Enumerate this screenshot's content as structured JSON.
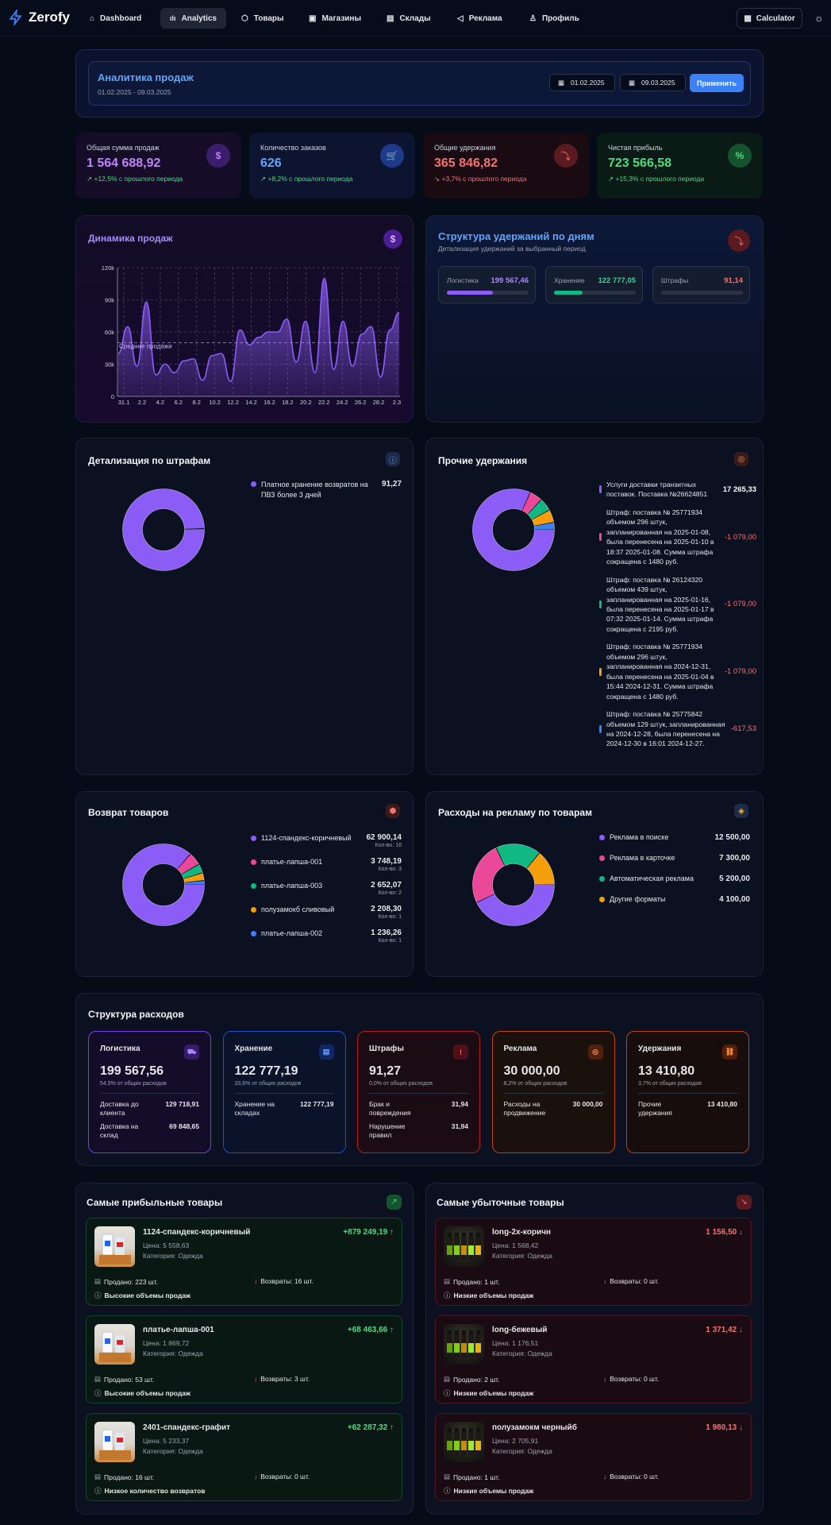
{
  "nav": {
    "logo": "Zerofy",
    "items": [
      "Dashboard",
      "Analytics",
      "Товары",
      "Магазины",
      "Склады",
      "Реклама",
      "Профиль"
    ],
    "calculator": "Calculator"
  },
  "header": {
    "title": "Аналитика продаж",
    "range": "01.02.2025 - 09.03.2025",
    "date_from": "01.02.2025",
    "date_to": "09.03.2025",
    "apply": "Применить"
  },
  "kpis": [
    {
      "label": "Общая сумма продаж",
      "value": "1 564 688,92",
      "trend": "+12,5% с прошлого периода",
      "color": "#c084fc"
    },
    {
      "label": "Количество заказов",
      "value": "626",
      "trend": "+8,2% с прошлого периода",
      "color": "#60a5fa"
    },
    {
      "label": "Общие удержания",
      "value": "365 846,82",
      "trend": "+3,7% с прошлого периода",
      "color": "#f87171"
    },
    {
      "label": "Чистая прибыль",
      "value": "723 566,58",
      "trend": "+15,3% с прошлого периода",
      "color": "#4ade80"
    }
  ],
  "sales_chart": {
    "title": "Динамика продаж",
    "avg_label": "Средние продажи",
    "chart_data": {
      "type": "area",
      "x": [
        "31.1",
        "2.2",
        "4.2",
        "6.2",
        "8.2",
        "10.2",
        "12.2",
        "14.2",
        "16.2",
        "18.2",
        "20.2",
        "22.2",
        "24.2",
        "26.2",
        "28.2",
        "2.3"
      ],
      "y_ticks": [
        "0",
        "30k",
        "60k",
        "90k",
        "120k"
      ],
      "ylim": [
        0,
        120000
      ],
      "avg": 50000,
      "values": [
        40000,
        65000,
        28000,
        88000,
        20000,
        30000,
        22000,
        33000,
        35000,
        15000,
        38000,
        40000,
        14000,
        62000,
        48000,
        55000,
        60000,
        60000,
        72000,
        32000,
        70000,
        22000,
        110000,
        25000,
        70000,
        28000,
        58000,
        65000,
        18000,
        62000,
        78000
      ]
    }
  },
  "deductions_struct": {
    "title": "Структура удержаний по дням",
    "subtitle": "Детализация удержаний за выбранный период",
    "items": [
      {
        "label": "Логистика",
        "value": "199 567,46",
        "fill": 0.56,
        "color": "#8b5cf6"
      },
      {
        "label": "Хранение",
        "value": "122 777,05",
        "fill": 0.35,
        "color": "#10b981"
      },
      {
        "label": "Штрафы",
        "value": "91,14",
        "fill": 0.0,
        "color": "#f87171"
      }
    ]
  },
  "fines": {
    "title": "Детализация по штрафам",
    "items": [
      {
        "label": "Платное хранение возвратов на ПВЗ более 3 дней",
        "value": "91,27",
        "color": "#8b5cf6"
      }
    ]
  },
  "other_ded": {
    "title": "Прочие удержания",
    "items": [
      {
        "label": "Услуги доставки транзитных поставок. Поставка №26624851",
        "value": "17 265,33",
        "color": "#8b5cf6",
        "neg": false
      },
      {
        "label": "Штраф: поставка № 25771934 объемом 296 штук, запланированная на 2025-01-08, была перенесена на 2025-01-10 в 18:37 2025-01-08. Сумма штрафа сокращена с 1480 руб.",
        "value": "-1 079,00",
        "color": "#ec4899",
        "neg": true
      },
      {
        "label": "Штраф: поставка № 26124320 объемом 439 штук, запланированная на 2025-01-16, была перенесена на 2025-01-17 в 07:32 2025-01-14. Сумма штрафа сокращена с 2195 руб.",
        "value": "-1 079,00",
        "color": "#10b981",
        "neg": true
      },
      {
        "label": "Штраф: поставка № 25771934 объемом 296 штук, запланированная на 2024-12-31, была перенесена на 2025-01-04 в 15:44 2024-12-31. Сумма штрафа сокращена с 1480 руб.",
        "value": "-1 079,00",
        "color": "#f59e0b",
        "neg": true
      },
      {
        "label": "Штраф: поставка № 25775842 объемом 129 штук, запланированная на 2024-12-28, была перенесена на 2024-12-30 в 16:01 2024-12-27.",
        "value": "-617,53",
        "color": "#3b82f6",
        "neg": true
      }
    ]
  },
  "returns": {
    "title": "Возврат товаров",
    "items": [
      {
        "label": "1124-спандекс-коричневый",
        "value": "62 900,14",
        "count": "Кол-во: 16",
        "color": "#8b5cf6"
      },
      {
        "label": "платье-лапша-001",
        "value": "3 748,19",
        "count": "Кол-во: 3",
        "color": "#ec4899"
      },
      {
        "label": "платье-лапша-003",
        "value": "2 652,07",
        "count": "Кол-во: 2",
        "color": "#10b981"
      },
      {
        "label": "полузамокб сливовый",
        "value": "2 208,30",
        "count": "Кол-во: 1",
        "color": "#f59e0b"
      },
      {
        "label": "платье-лапша-002",
        "value": "1 236,26",
        "count": "Кол-во: 1",
        "color": "#3b82f6"
      }
    ]
  },
  "ads": {
    "title": "Расходы на рекламу по товарам",
    "items": [
      {
        "label": "Реклама в поиске",
        "value": "12 500,00",
        "color": "#8b5cf6"
      },
      {
        "label": "Реклама в карточке",
        "value": "7 300,00",
        "color": "#ec4899"
      },
      {
        "label": "Автоматическая реклама",
        "value": "5 200,00",
        "color": "#10b981"
      },
      {
        "label": "Другие форматы",
        "value": "4 100,00",
        "color": "#f59e0b"
      }
    ]
  },
  "expenses": {
    "title": "Структура расходов",
    "cards": [
      {
        "title": "Логистика",
        "value": "199 567,56",
        "pct": "54,5% от общих расходов",
        "border": "#7c3aed",
        "bg": "#140d2a",
        "accent": "#a78bfa",
        "rows": [
          [
            "Доставка до клиента",
            "129 718,91"
          ],
          [
            "Доставка на склад",
            "69 848,65"
          ]
        ]
      },
      {
        "title": "Хранение",
        "value": "122 777,19",
        "pct": "33,6% от общих расходов",
        "border": "#1d4ed8",
        "bg": "#0b132a",
        "accent": "#60a5fa",
        "rows": [
          [
            "Хранение на складах",
            "122 777,19"
          ]
        ]
      },
      {
        "title": "Штрафы",
        "value": "91,27",
        "pct": "0,0% от общих расходов",
        "border": "#b91c1c",
        "bg": "#1a0c12",
        "accent": "#f87171",
        "rows": [
          [
            "Брак и повреждения",
            "31,94"
          ],
          [
            "Нарушение правил",
            "31,94"
          ]
        ]
      },
      {
        "title": "Реклама",
        "value": "30 000,00",
        "pct": "8,2% от общих расходов",
        "border": "#c2410c",
        "bg": "#1a100c",
        "accent": "#fb923c",
        "rows": [
          [
            "Расходы на продвижение",
            "30 000,00"
          ]
        ]
      },
      {
        "title": "Удержания",
        "value": "13 410,80",
        "pct": "3,7% от общих расходов",
        "border": "#c2410c",
        "bg": "#170d0d",
        "accent": "#fb923c",
        "rows": [
          [
            "Прочие удержания",
            "13 410,80"
          ]
        ]
      }
    ]
  },
  "profitable": {
    "title": "Самые прибыльные товары",
    "items": [
      {
        "name": "1124-спандекс-коричневый",
        "price": "Цена: 5 558,63",
        "cat": "Категория: Одежда",
        "amount": "+879 249,19",
        "sold": "Продано: 223 шт.",
        "ret": "Возвраты: 16 шт.",
        "note": "Высокие объемы продаж"
      },
      {
        "name": "платье-лапша-001",
        "price": "Цена: 1 869,72",
        "cat": "Категория: Одежда",
        "amount": "+68 463,66",
        "sold": "Продано: 53 шт.",
        "ret": "Возвраты: 3 шт.",
        "note": "Высокие объемы продаж"
      },
      {
        "name": "2401-спандекс-графит",
        "price": "Цена: 5 233,37",
        "cat": "Категория: Одежда",
        "amount": "+62 287,32",
        "sold": "Продано: 16 шт.",
        "ret": "Возвраты: 0 шт.",
        "note": "Низкое количество возвратов"
      }
    ]
  },
  "unprofitable": {
    "title": "Самые убыточные товары",
    "items": [
      {
        "name": "long-2x-коричн",
        "price": "Цена: 1 568,42",
        "cat": "Категория: Одежда",
        "amount": "1 156,50",
        "sold": "Продано: 1 шт.",
        "ret": "Возвраты: 0 шт.",
        "note": "Низкие объемы продаж"
      },
      {
        "name": "long-бежевый",
        "price": "Цена: 1 176,51",
        "cat": "Категория: Одежда",
        "amount": "1 371,42",
        "sold": "Продано: 2 шт.",
        "ret": "Возвраты: 0 шт.",
        "note": "Низкие объемы продаж"
      },
      {
        "name": "полузамокм черныйб",
        "price": "Цена: 2 705,91",
        "cat": "Категория: Одежда",
        "amount": "1 980,13",
        "sold": "Продано: 1 шт.",
        "ret": "Возвраты: 0 шт.",
        "note": "Низкие объемы продаж"
      }
    ]
  }
}
